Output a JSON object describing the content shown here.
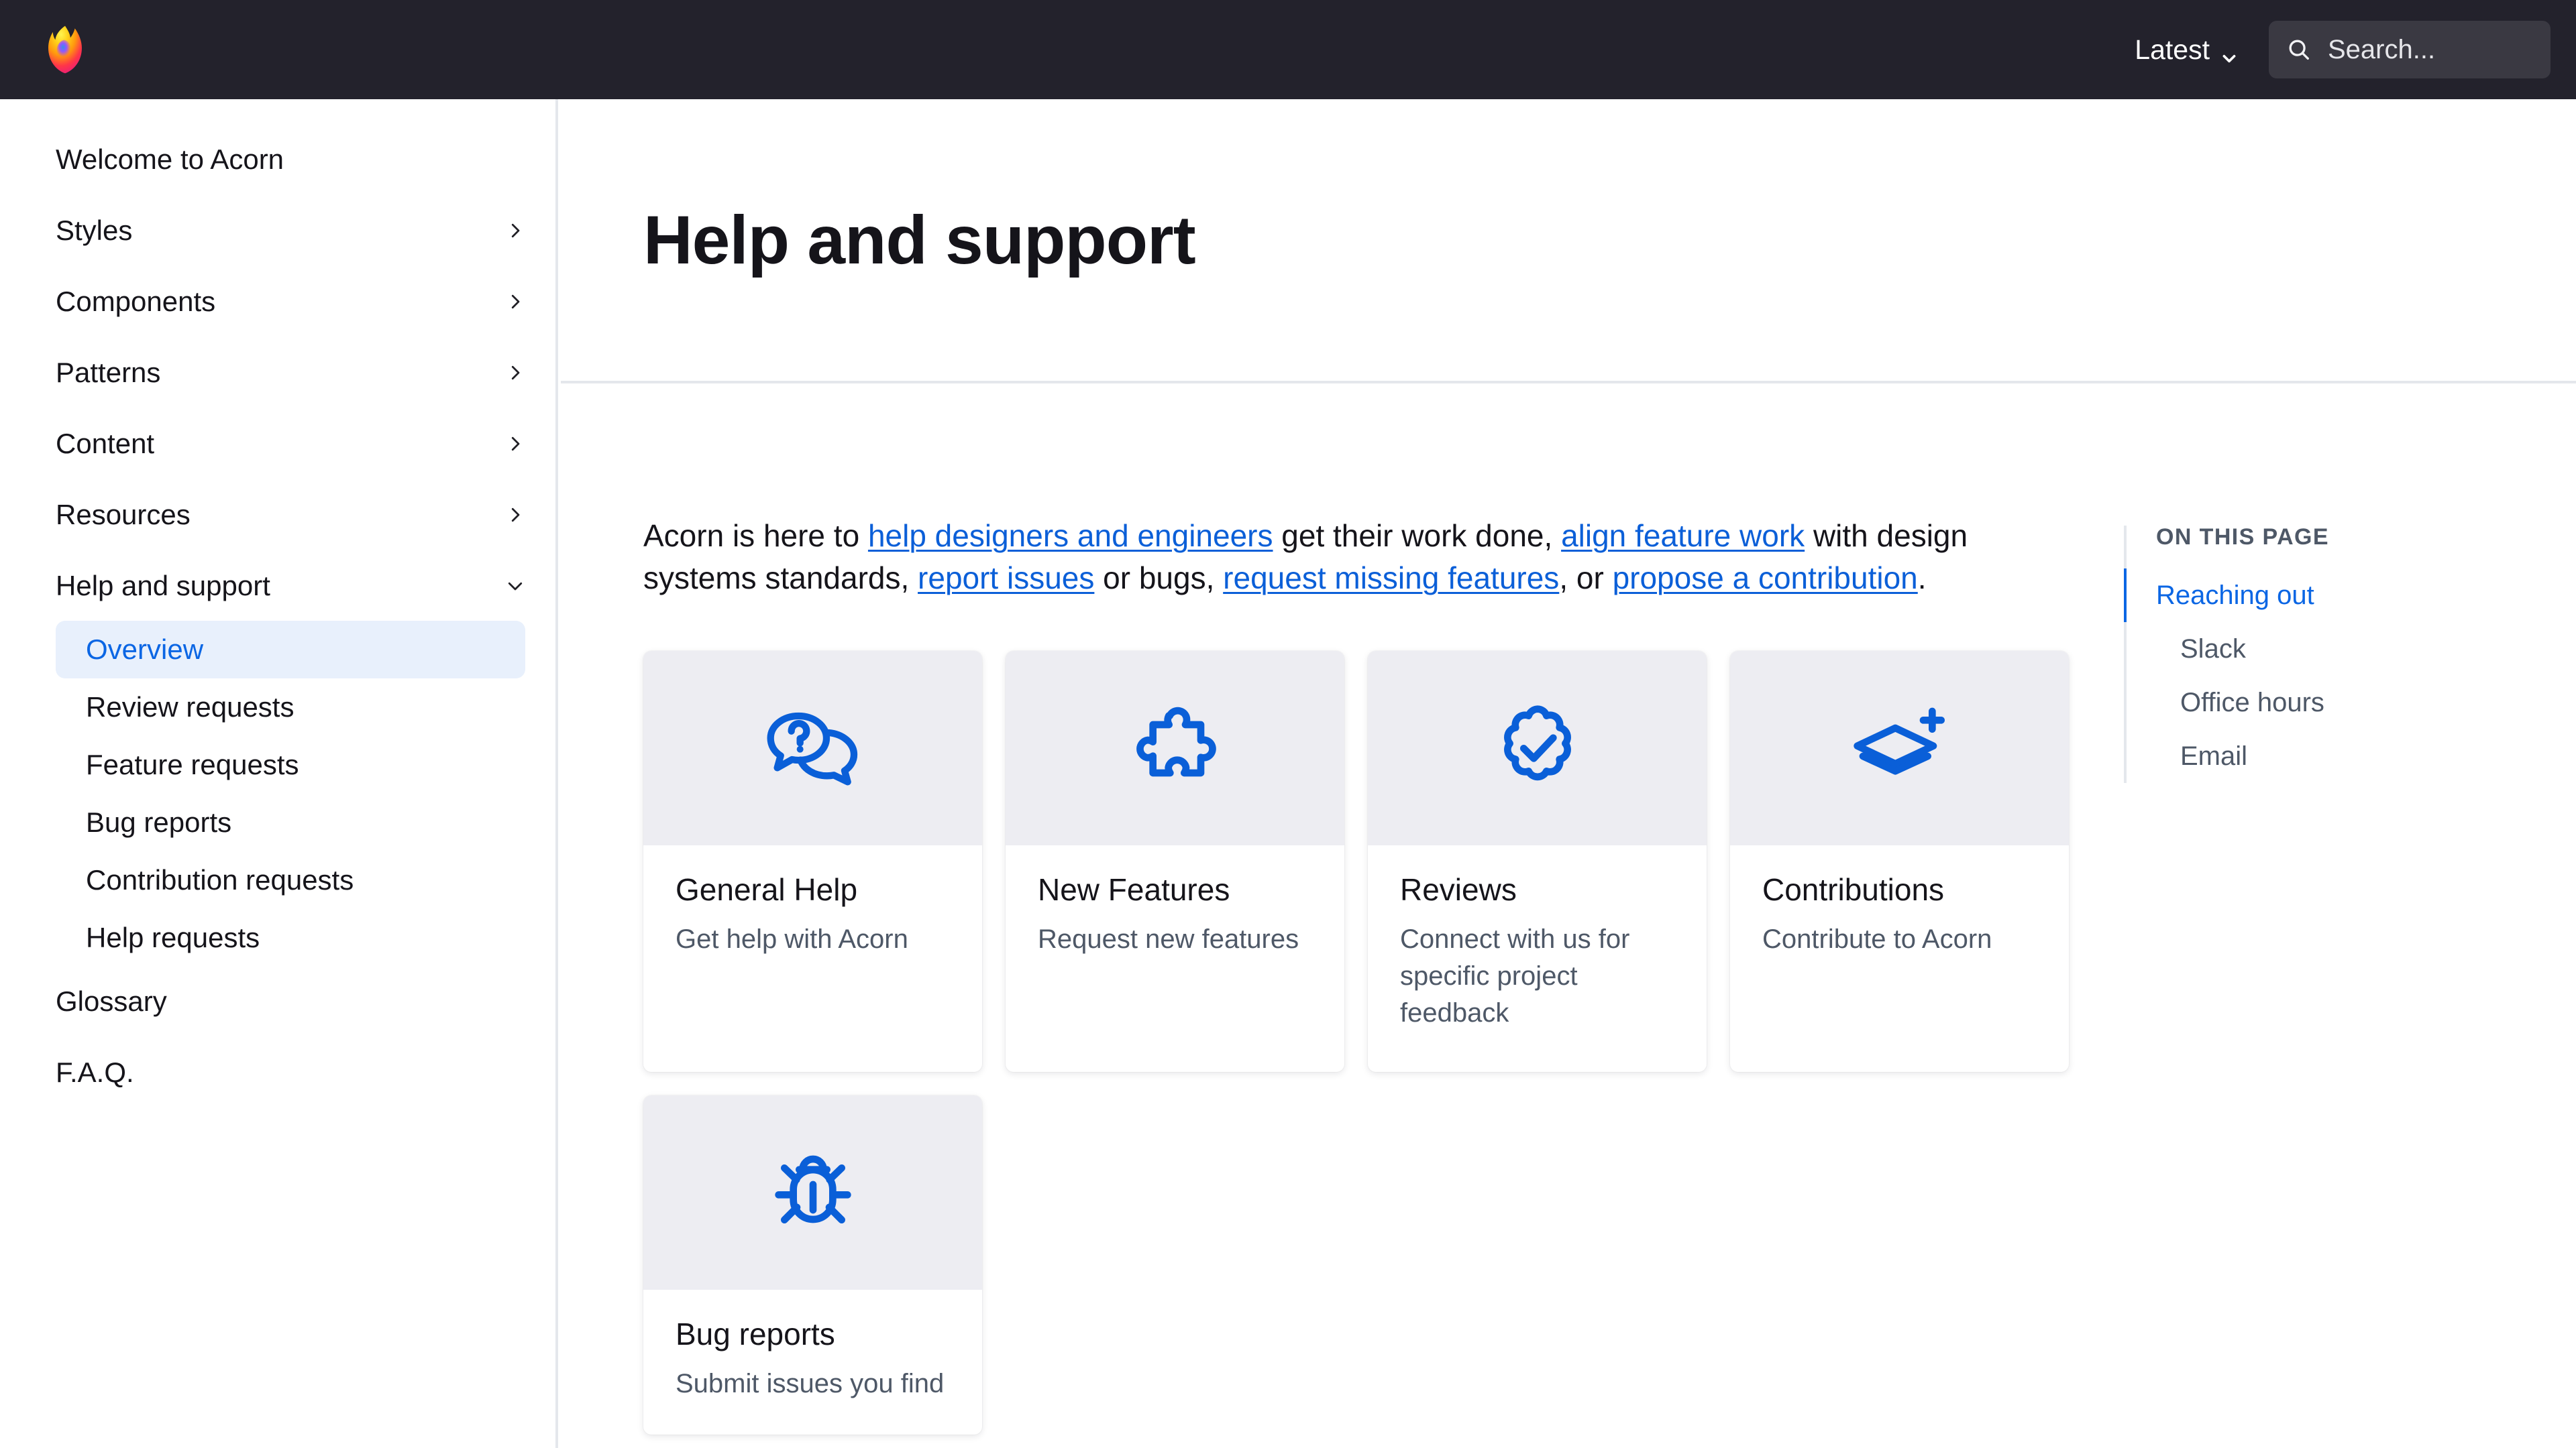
{
  "header": {
    "logo_icon": "firefox-logo",
    "version_label": "Latest",
    "version_chevron_icon": "chevron-down-icon",
    "search": {
      "icon": "search-icon",
      "placeholder": "Search...",
      "value": ""
    }
  },
  "sidebar": {
    "items": [
      {
        "label": "Welcome to Acorn",
        "expandable": false
      },
      {
        "label": "Styles",
        "expandable": true,
        "icon": "chevron-right-icon"
      },
      {
        "label": "Components",
        "expandable": true,
        "icon": "chevron-right-icon"
      },
      {
        "label": "Patterns",
        "expandable": true,
        "icon": "chevron-right-icon"
      },
      {
        "label": "Content",
        "expandable": true,
        "icon": "chevron-right-icon"
      },
      {
        "label": "Resources",
        "expandable": true,
        "icon": "chevron-right-icon"
      },
      {
        "label": "Help and support",
        "expandable": true,
        "expanded": true,
        "icon": "chevron-down-icon"
      }
    ],
    "help_children": [
      {
        "label": "Overview",
        "active": true
      },
      {
        "label": "Review requests",
        "active": false
      },
      {
        "label": "Feature requests",
        "active": false
      },
      {
        "label": "Bug reports",
        "active": false
      },
      {
        "label": "Contribution requests",
        "active": false
      },
      {
        "label": "Help requests",
        "active": false
      }
    ],
    "trailing_items": [
      {
        "label": "Glossary"
      },
      {
        "label": "F.A.Q."
      }
    ]
  },
  "main": {
    "page_title": "Help and support",
    "intro": {
      "segments": [
        {
          "text": "Acorn is here to ",
          "link": false
        },
        {
          "text": "help designers and engineers",
          "link": true
        },
        {
          "text": " get their work done, ",
          "link": false
        },
        {
          "text": "align feature work",
          "link": true
        },
        {
          "text": " with design systems standards, ",
          "link": false
        },
        {
          "text": "report issues",
          "link": true
        },
        {
          "text": " or bugs, ",
          "link": false
        },
        {
          "text": "request missing features",
          "link": true
        },
        {
          "text": ", or ",
          "link": false
        },
        {
          "text": "propose a contribution",
          "link": true
        },
        {
          "text": ".",
          "link": false
        }
      ]
    },
    "cards": [
      {
        "title": "General Help",
        "desc": "Get help with Acorn",
        "icon": "chat-question-icon"
      },
      {
        "title": "New Features",
        "desc": "Request new features",
        "icon": "puzzle-piece-icon"
      },
      {
        "title": "Reviews",
        "desc": "Connect with us for specific project feedback",
        "icon": "badge-check-icon"
      },
      {
        "title": "Contributions",
        "desc": "Contribute to Acorn",
        "icon": "layers-plus-icon"
      },
      {
        "title": "Bug reports",
        "desc": "Submit issues you find",
        "icon": "bug-icon"
      }
    ]
  },
  "toc": {
    "heading": "ON THIS PAGE",
    "links": [
      {
        "label": "Reaching out",
        "active": true,
        "sub": false
      },
      {
        "label": "Slack",
        "active": false,
        "sub": true
      },
      {
        "label": "Office hours",
        "active": false,
        "sub": true
      },
      {
        "label": "Email",
        "active": false,
        "sub": true
      }
    ]
  },
  "colors": {
    "header_bg": "#23222C",
    "search_bg": "#3A3942",
    "accent_blue": "#0B66E4",
    "link_blue": "#0B5FD8",
    "active_pill_bg": "#E8F0FC",
    "card_media_bg": "#EDEDF2",
    "divider": "#E4E7EC",
    "text_primary": "#15141A",
    "text_secondary": "#4E5867"
  }
}
